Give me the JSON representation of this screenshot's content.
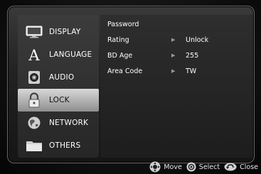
{
  "side_menu": {
    "items": [
      {
        "label": "DISPLAY",
        "icon": "tv-icon"
      },
      {
        "label": "LANGUAGE",
        "icon": "letter-a-icon"
      },
      {
        "label": "AUDIO",
        "icon": "speaker-icon"
      },
      {
        "label": "LOCK",
        "icon": "padlock-icon",
        "selected": true
      },
      {
        "label": "NETWORK",
        "icon": "globe-icon"
      },
      {
        "label": "OTHERS",
        "icon": "folder-icon"
      }
    ]
  },
  "options": {
    "rows": [
      {
        "label": "Password",
        "value": ""
      },
      {
        "label": "Rating",
        "value": "Unlock"
      },
      {
        "label": "BD Age",
        "value": "255"
      },
      {
        "label": "Area Code",
        "value": "TW"
      }
    ]
  },
  "help_bar": {
    "move_label": "Move",
    "select_label": "Select",
    "close_label": "Close"
  },
  "colors": {
    "selected_bg": "#c8c8c8",
    "text": "#ffffff",
    "background": "#050505"
  }
}
